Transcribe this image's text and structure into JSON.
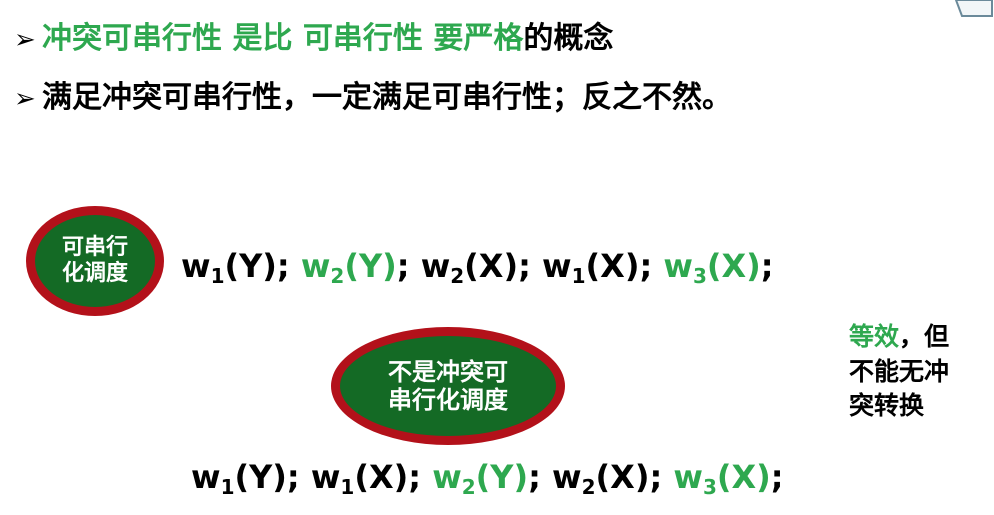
{
  "bullets": {
    "line1": {
      "marker": "➢",
      "part1": "冲突可串行性 是比 可串行性 要严格",
      "part2": "的概念"
    },
    "line2": {
      "marker": "➢",
      "text": "满足冲突可串行性，一定满足可串行性；反之不然。"
    }
  },
  "labels": {
    "serializable_line1": "可串行",
    "serializable_line2": "化调度",
    "not_conflict_line1": "不是冲突可",
    "not_conflict_line2": "串行化调度"
  },
  "schedule1": [
    {
      "op": "w",
      "sub": "1",
      "arg": "(Y);",
      "color": "black"
    },
    {
      "op": "w",
      "sub": "2",
      "arg": "(Y)",
      "color": "green"
    },
    {
      "op": "",
      "sub": "",
      "arg": ";",
      "color": "black"
    },
    {
      "op": "w",
      "sub": "2",
      "arg": "(X);",
      "color": "black"
    },
    {
      "op": "w",
      "sub": "1",
      "arg": "(X);",
      "color": "black"
    },
    {
      "op": "w",
      "sub": "3",
      "arg": "(X)",
      "color": "green"
    },
    {
      "op": "",
      "sub": "",
      "arg": ";",
      "color": "black"
    }
  ],
  "schedule2": [
    {
      "op": "w",
      "sub": "1",
      "arg": "(Y);",
      "color": "black"
    },
    {
      "op": "w",
      "sub": "1",
      "arg": "(X);",
      "color": "black"
    },
    {
      "op": "w",
      "sub": "2",
      "arg": "(Y)",
      "color": "green"
    },
    {
      "op": "",
      "sub": "",
      "arg": ";",
      "color": "black"
    },
    {
      "op": "w",
      "sub": "2",
      "arg": "(X);",
      "color": "black"
    },
    {
      "op": "w",
      "sub": "3",
      "arg": "(X)",
      "color": "green"
    },
    {
      "op": "",
      "sub": "",
      "arg": ";",
      "color": "black"
    }
  ],
  "note": {
    "equivalent": "等效",
    "sep": "，但",
    "line2": "不能无冲",
    "line3": "突转换"
  },
  "colors": {
    "green_text": "#2ea84f",
    "ellipse_fill": "#146a25",
    "ellipse_border": "#b3111a"
  }
}
